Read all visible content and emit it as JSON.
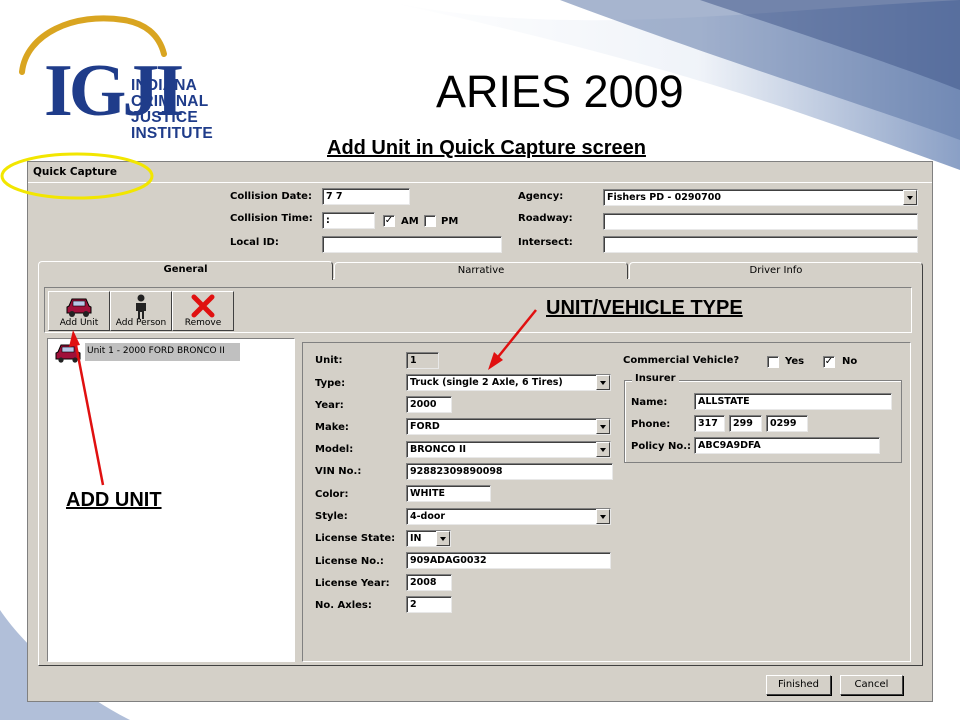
{
  "slide": {
    "title": "ARIES 2009",
    "subtitle": "Add Unit in Quick Capture screen",
    "logo_letters": "IGJI",
    "logo_lines": [
      "INDIANA",
      "CRIMINAL",
      "JUSTICE",
      "INSTITUTE"
    ]
  },
  "annotations": {
    "unit_vehicle_type": "UNIT/VEHICLE TYPE",
    "add_unit": "ADD UNIT"
  },
  "window": {
    "title": "Quick Capture",
    "header": {
      "collision_date_label": "Collision Date:",
      "collision_date_value": " 7  7",
      "collision_time_label": "Collision Time:",
      "collision_time_value": " :",
      "am_label": "AM",
      "am_checked": true,
      "pm_label": "PM",
      "pm_checked": false,
      "local_id_label": "Local ID:",
      "local_id_value": "",
      "agency_label": "Agency:",
      "agency_value": "Fishers PD - 0290700",
      "roadway_label": "Roadway:",
      "roadway_value": "",
      "intersect_label": "Intersect:",
      "intersect_value": ""
    },
    "tabs": [
      {
        "label": "General",
        "active": true
      },
      {
        "label": "Narrative",
        "active": false
      },
      {
        "label": "Driver Info",
        "active": false
      }
    ],
    "toolbar": {
      "add_unit": "Add Unit",
      "add_person": "Add Person",
      "remove": "Remove"
    },
    "unit_list": [
      {
        "label": "Unit 1 - 2000 FORD BRONCO II"
      }
    ],
    "unit": {
      "unit_label": "Unit:",
      "unit_value": "1",
      "type_label": "Type:",
      "type_value": "Truck (single 2 Axle, 6 Tires)",
      "year_label": "Year:",
      "year_value": "2000",
      "make_label": "Make:",
      "make_value": "FORD",
      "model_label": "Model:",
      "model_value": "BRONCO II",
      "vin_label": "VIN No.:",
      "vin_value": "92882309890098",
      "color_label": "Color:",
      "color_value": "WHITE",
      "style_label": "Style:",
      "style_value": "4-door",
      "license_state_label": "License State:",
      "license_state_value": "IN",
      "license_no_label": "License No.:",
      "license_no_value": "909ADAG0032",
      "license_year_label": "License Year:",
      "license_year_value": "2008",
      "axles_label": "No. Axles:",
      "axles_value": "2",
      "commercial_label": "Commercial Vehicle?",
      "yes_label": "Yes",
      "yes_checked": false,
      "no_label": "No",
      "no_checked": true
    },
    "insurer": {
      "legend": "Insurer",
      "name_label": "Name:",
      "name_value": "ALLSTATE",
      "phone_label": "Phone:",
      "phone_area": "317",
      "phone_prefix": "299",
      "phone_line": "0299",
      "policy_label": "Policy No.:",
      "policy_value": "ABC9A9DFA"
    },
    "buttons": {
      "finished": "Finished",
      "cancel": "Cancel"
    }
  },
  "colors": {
    "logo_blue": "#1f3c8a",
    "logo_gold": "#d9a521",
    "highlight_yellow": "#f2e600",
    "arrow_red": "#e01010",
    "window_face": "#d4d0c8"
  }
}
